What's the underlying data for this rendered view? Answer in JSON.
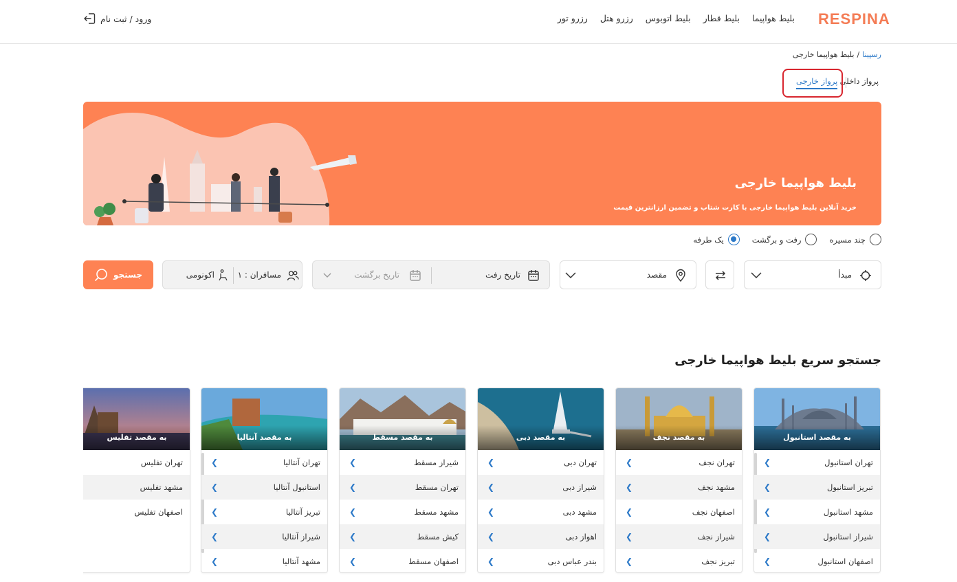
{
  "brand": {
    "logo": "RESPINA",
    "accent": "#fe8253",
    "link": "#2c79c8"
  },
  "nav": [
    "بلیط هواپیما",
    "بلیط قطار",
    "بلیط اتوبوس",
    "رزرو هتل",
    "رزرو تور"
  ],
  "login": "ورود / ثبت نام",
  "breadcrumb": {
    "home": "رسپینا",
    "sep": "/",
    "current": "بلیط هواپیما خارجی"
  },
  "tabs": {
    "domestic": "پرواز داخلی",
    "foreign": "پرواز خارجی"
  },
  "banner": {
    "title": "بلیط هواپیما خارجی",
    "subtitle": "خرید آنلاین بلیط هواپیما خارجی با کارت شتاب و تضمین ارزانترین قیمت"
  },
  "trip_types": {
    "one_way": "یک طرفه",
    "round_trip": "رفت و برگشت",
    "multi": "چند مسیره",
    "selected": "one_way"
  },
  "search": {
    "origin": "مبدأ",
    "destination": "مقصد",
    "depart": "تاریخ رفت",
    "return": "تاریخ برگشت",
    "passengers": "مسافران : ۱",
    "cabin": "اکونومی",
    "button": "جستجو"
  },
  "quick_title": "جستجو سریع بلیط هواپیما خارجی",
  "cards": [
    {
      "caption": "به مقصد استانبول",
      "routes": [
        "تهران استانبول",
        "تبریز استانبول",
        "مشهد استانبول",
        "شیراز استانبول",
        "اصفهان استانبول"
      ]
    },
    {
      "caption": "به مقصد نجف",
      "routes": [
        "تهران نجف",
        "مشهد نجف",
        "اصفهان نجف",
        "شیراز نجف",
        "تبریز نجف"
      ]
    },
    {
      "caption": "به مقصد دبی",
      "routes": [
        "تهران دبی",
        "شیراز دبی",
        "مشهد دبی",
        "اهواز دبی",
        "بندر عباس دبی"
      ]
    },
    {
      "caption": "به مقصد مسقط",
      "routes": [
        "شیراز مسقط",
        "تهران مسقط",
        "مشهد مسقط",
        "کیش مسقط",
        "اصفهان مسقط"
      ]
    },
    {
      "caption": "به مقصد آنتالیا",
      "routes": [
        "تهران آنتالیا",
        "استانبول آنتالیا",
        "تبریز آنتالیا",
        "شیراز آنتالیا",
        "مشهد آنتالیا"
      ]
    },
    {
      "caption": "به مقصد تفلیس",
      "routes": [
        "تهران تفلیس",
        "مشهد تفلیس",
        "اصفهان تفلیس"
      ]
    }
  ]
}
